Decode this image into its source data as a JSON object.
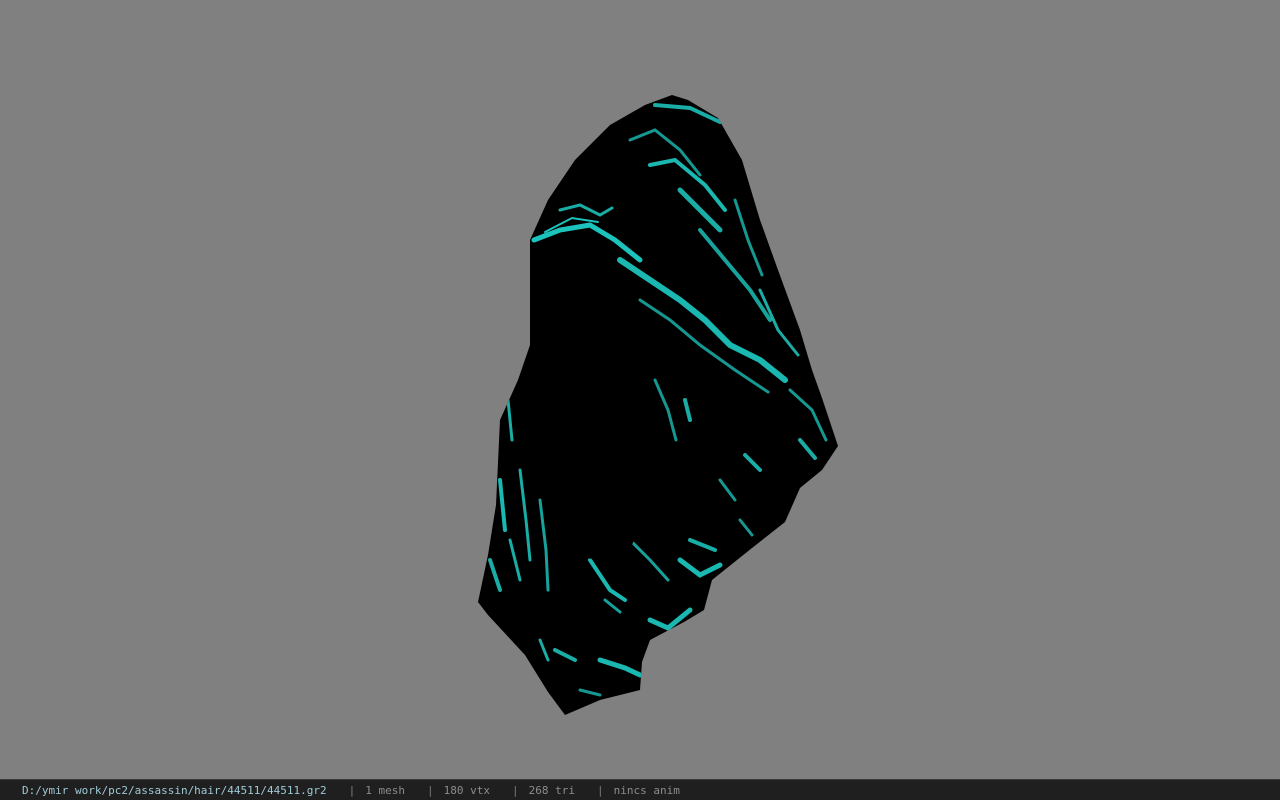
{
  "viewport": {
    "background": "#808080",
    "model_colors": {
      "base": "#000000",
      "accent": "#1fd8d0"
    }
  },
  "statusbar": {
    "file_path": "D:/ymir work/pc2/assassin/hair/44511/44511.gr2",
    "separator": "|",
    "mesh_count": "1 mesh",
    "vertex_count": "180 vtx",
    "triangle_count": "268 tri",
    "anim_status": "nincs anim"
  }
}
